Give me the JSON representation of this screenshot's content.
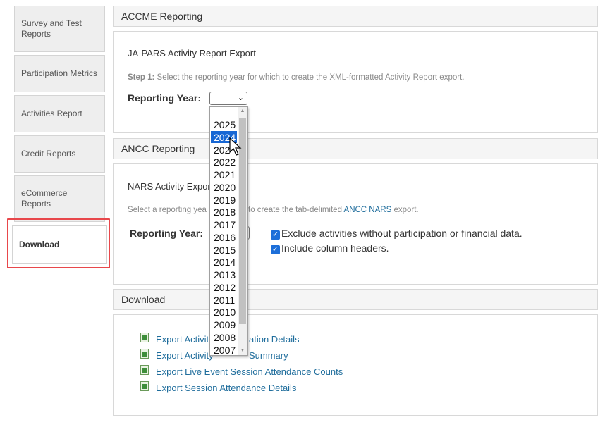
{
  "sidebar": {
    "items": [
      {
        "label": "Survey and Test Reports"
      },
      {
        "label": "Participation Metrics"
      },
      {
        "label": "Activities Report"
      },
      {
        "label": "Credit Reports"
      },
      {
        "label": "eCommerce Reports"
      },
      {
        "label": "Download",
        "active": true
      }
    ]
  },
  "accme": {
    "header": "ACCME Reporting",
    "subtitle": "JA-PARS Activity Report Export",
    "step_bold": "Step 1:",
    "step_text": " Select the reporting year for which to create the XML-formatted Activity Report export.",
    "year_label": "Reporting Year:",
    "year_value": ""
  },
  "ancc": {
    "header": "ANCC Reporting",
    "subtitle_visible": "NARS Activity Expor",
    "desc_left": "Select a reporting yea",
    "desc_right": " to create the tab-delimited ",
    "desc_link": "ANCC NARS",
    "desc_end": " export.",
    "year_label": "Reporting Year:",
    "checkbox1": "Exclude activities without participation or financial data.",
    "checkbox2": "Include column headers."
  },
  "download": {
    "header": "Download",
    "links": [
      {
        "left": "Export Activit",
        "right": "ation Details"
      },
      {
        "left": "Export Activity",
        "right": "Summary"
      },
      {
        "full": "Export Live Event Session Attendance Counts"
      },
      {
        "full": "Export Session Attendance Details"
      }
    ]
  },
  "dropdown": {
    "options": [
      "2025",
      "2024",
      "202",
      "2022",
      "2021",
      "2020",
      "2019",
      "2018",
      "2017",
      "2016",
      "2015",
      "2014",
      "2013",
      "2012",
      "2011",
      "2010",
      "2009",
      "2008",
      "2007"
    ],
    "selected": "2024"
  },
  "colors": {
    "highlight": "#e8474b",
    "link": "#1f6d9c",
    "selection": "#1767d4"
  }
}
